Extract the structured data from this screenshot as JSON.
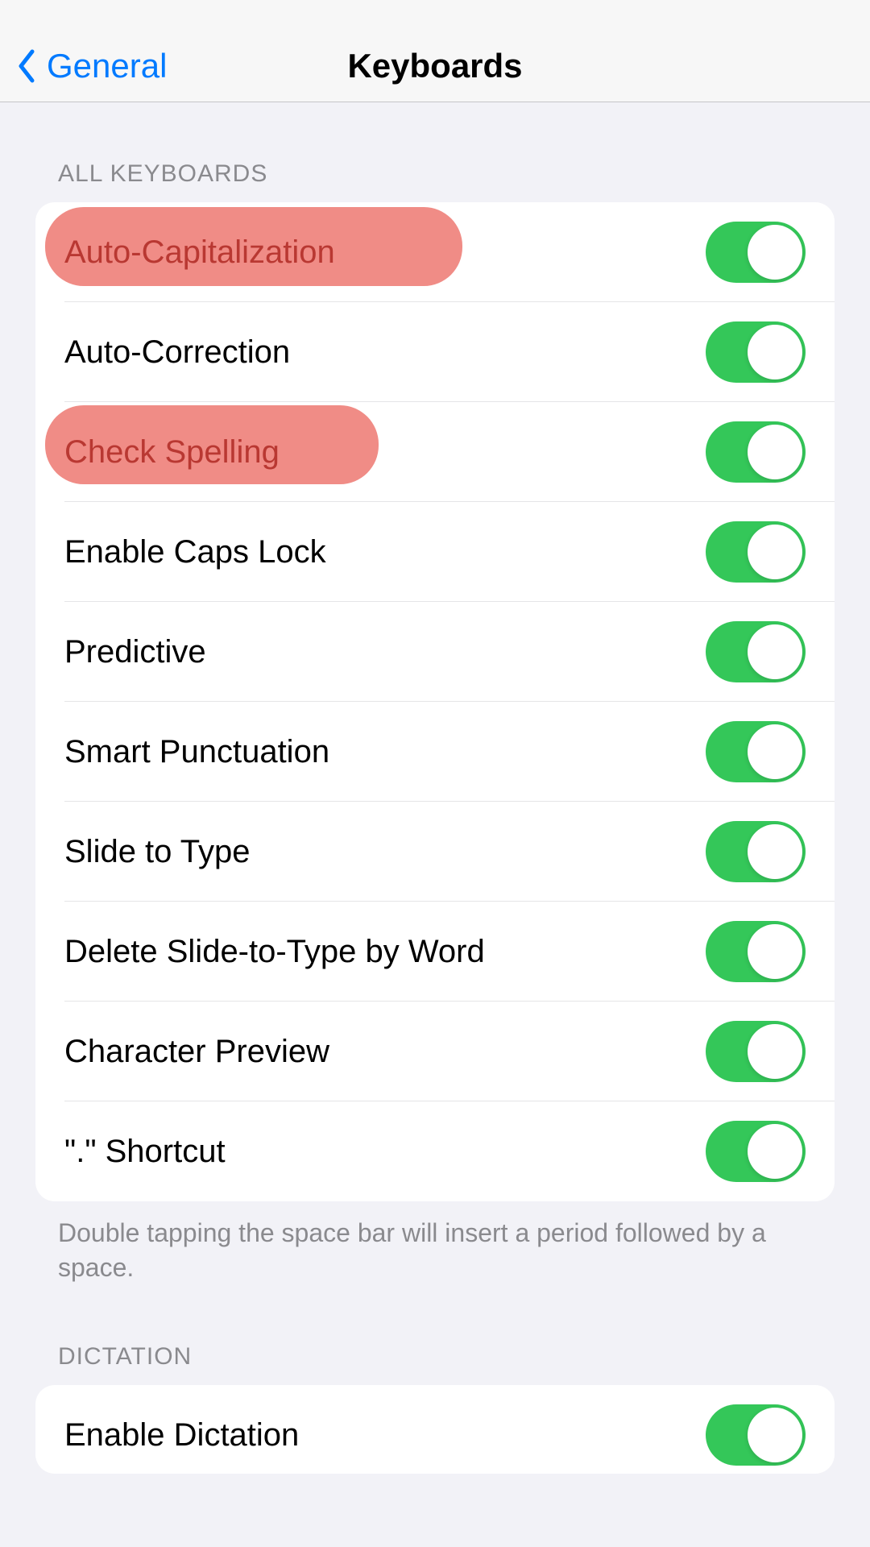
{
  "nav": {
    "back_label": "General",
    "title": "Keyboards"
  },
  "sections": {
    "all_keyboards": {
      "header": "ALL KEYBOARDS",
      "items": [
        {
          "label": "Auto-Capitalization",
          "on": true,
          "highlighted": true
        },
        {
          "label": "Auto-Correction",
          "on": true,
          "highlighted": false
        },
        {
          "label": "Check Spelling",
          "on": true,
          "highlighted": true
        },
        {
          "label": "Enable Caps Lock",
          "on": true,
          "highlighted": false
        },
        {
          "label": "Predictive",
          "on": true,
          "highlighted": false
        },
        {
          "label": "Smart Punctuation",
          "on": true,
          "highlighted": false
        },
        {
          "label": "Slide to Type",
          "on": true,
          "highlighted": false
        },
        {
          "label": "Delete Slide-to-Type by Word",
          "on": true,
          "highlighted": false
        },
        {
          "label": "Character Preview",
          "on": true,
          "highlighted": false
        },
        {
          "label": "\".\" Shortcut",
          "on": true,
          "highlighted": false
        }
      ],
      "footer": "Double tapping the space bar will insert a period followed by a space."
    },
    "dictation": {
      "header": "DICTATION",
      "items": [
        {
          "label": "Enable Dictation",
          "on": true,
          "highlighted": false
        }
      ]
    }
  },
  "colors": {
    "accent_blue": "#007aff",
    "toggle_green": "#34c759",
    "highlight_color": "#f08c86",
    "highlight_text": "#b93832"
  }
}
